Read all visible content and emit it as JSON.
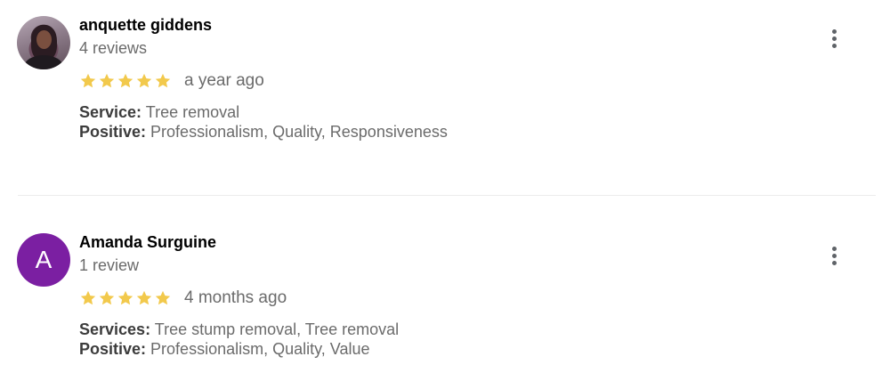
{
  "colors": {
    "star": "#F2C94C",
    "avatar_letter_bg": "#7B1FA2",
    "name": "#000000",
    "secondary_text": "#6B6B6B"
  },
  "reviews": [
    {
      "avatar_type": "photo",
      "avatar_letter": "",
      "name": "anquette giddens",
      "review_count": "4 reviews",
      "rating": 5,
      "time": "a year ago",
      "details": [
        {
          "label": "Service:",
          "value": "Tree removal"
        },
        {
          "label": "Positive:",
          "value": "Professionalism, Quality, Responsiveness"
        }
      ],
      "menu_icon": "more-vert-icon"
    },
    {
      "avatar_type": "letter",
      "avatar_letter": "A",
      "name": "Amanda Surguine",
      "review_count": "1 review",
      "rating": 5,
      "time": "4 months ago",
      "details": [
        {
          "label": "Services:",
          "value": "Tree stump removal, Tree removal"
        },
        {
          "label": "Positive:",
          "value": "Professionalism, Quality, Value"
        }
      ],
      "menu_icon": "more-vert-icon"
    }
  ]
}
